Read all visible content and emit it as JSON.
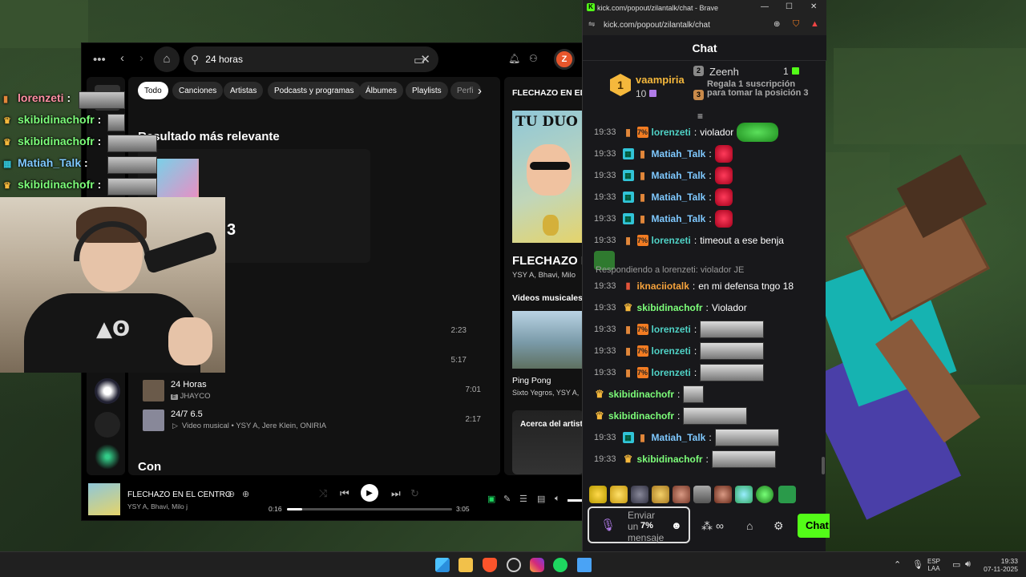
{
  "spotify": {
    "search_value": "24 horas",
    "avatar_letter": "Z",
    "filters": [
      "Todo",
      "Canciones",
      "Artistas",
      "Podcasts y programas",
      "Álbumes",
      "Playlists",
      "Perfi"
    ],
    "relevant_title": "Resultado más relevante",
    "relevant_fragment": "3",
    "durations": [
      "2:23",
      "5:17"
    ],
    "songs": [
      {
        "title": "24 Horas",
        "explicit": "E",
        "subtitle": "JHAYCO",
        "duration": "7:01"
      },
      {
        "title": "24/7 6.5",
        "explicit": "▷",
        "subtitle": "Video musical • YSY A, Jere Klein, ONIRIA",
        "duration": "2:17"
      }
    ],
    "section_con": "Con",
    "now_playing_panel": {
      "header": "FLECHAZO EN EL C",
      "cover_text": "TU DUO",
      "title": "FLECHAZO E",
      "artists": "YSY A, Bhavi, Milo",
      "videos_label": "Videos musicales",
      "video_title": "Ping Pong",
      "video_artists": "Sixto Yegros, YSY A,",
      "about_label": "Acerca del artista"
    },
    "player": {
      "title": "FLECHAZO EN EL CENTRO",
      "artists": "YSY A, Bhavi, Milo j",
      "elapsed": "0:16",
      "total": "3:05",
      "progress": 0.09
    }
  },
  "overlay_chat": [
    {
      "user": "lorenzeti",
      "color": "#ff8fa3",
      "suffix": ":"
    },
    {
      "user": "skibidinachofr",
      "color": "#7dff7a",
      "suffix": ":"
    },
    {
      "user": "skibidinachofr",
      "color": "#7dff7a",
      "suffix": ":"
    },
    {
      "user": "Matiah_Talk",
      "color": "#7fc9ff",
      "suffix": ":"
    },
    {
      "user": "skibidinachofr",
      "color": "#7dff7a",
      "suffix": ":"
    }
  ],
  "browser": {
    "title": "kick.com/popout/zilantalk/chat - Brave",
    "url": "kick.com/popout/zilantalk/chat",
    "chat_header": "Chat"
  },
  "leaderboard": {
    "first": {
      "rank": "1",
      "name": "vaampiria",
      "count": "10"
    },
    "second": {
      "rank": "2",
      "name": "Zeenh",
      "count": "1"
    },
    "third": {
      "rank": "3",
      "text": "Regala 1 suscripción para tomar la posición 3"
    }
  },
  "messages": [
    {
      "time": "19:33",
      "badges": [
        "cup",
        "pct"
      ],
      "user": "lorenzeti",
      "color": "#4fd1c5",
      "text": "violador",
      "emote": "green"
    },
    {
      "time": "19:33",
      "badges": [
        "kg",
        "cup"
      ],
      "user": "Matiah_Talk",
      "color": "#7fc9ff",
      "text": "",
      "emote": "red"
    },
    {
      "time": "19:33",
      "badges": [
        "kg",
        "cup"
      ],
      "user": "Matiah_Talk",
      "color": "#7fc9ff",
      "text": "",
      "emote": "red"
    },
    {
      "time": "19:33",
      "badges": [
        "kg",
        "cup"
      ],
      "user": "Matiah_Talk",
      "color": "#7fc9ff",
      "text": "",
      "emote": "red"
    },
    {
      "time": "19:33",
      "badges": [
        "kg",
        "cup"
      ],
      "user": "Matiah_Talk",
      "color": "#7fc9ff",
      "text": "",
      "emote": "red"
    },
    {
      "time": "19:33",
      "badges": [
        "cup",
        "pct"
      ],
      "user": "lorenzeti",
      "color": "#4fd1c5",
      "text": "timeout a ese benja",
      "emote": "frog"
    },
    {
      "time": "19:33",
      "badges": [
        "gift"
      ],
      "user": "iknaciiotalk",
      "color": "#f5a23c",
      "text": "en mi defensa tngo 18",
      "emote": "",
      "reply": "Respondiendo a lorenzeti: violador JE"
    },
    {
      "time": "19:33",
      "badges": [
        "crown"
      ],
      "user": "skibidinachofr",
      "color": "#7dff7a",
      "text": "Violador",
      "emote": ""
    },
    {
      "time": "19:33",
      "badges": [
        "cup",
        "pct"
      ],
      "user": "lorenzeti",
      "color": "#4fd1c5",
      "text": "",
      "emote": "face"
    },
    {
      "time": "19:33",
      "badges": [
        "cup",
        "pct"
      ],
      "user": "lorenzeti",
      "color": "#4fd1c5",
      "text": "",
      "emote": "face"
    },
    {
      "time": "19:33",
      "badges": [
        "cup",
        "pct"
      ],
      "user": "lorenzeti",
      "color": "#4fd1c5",
      "text": "",
      "emote": "face"
    },
    {
      "time": "",
      "badges": [
        "crown"
      ],
      "user": "skibidinachofr",
      "color": "#7dff7a",
      "text": "",
      "emote": "smallface"
    },
    {
      "time": "",
      "badges": [
        "crown"
      ],
      "user": "skibidinachofr",
      "color": "#7dff7a",
      "text": "",
      "emote": "face"
    },
    {
      "time": "19:33",
      "badges": [
        "kg",
        "cup"
      ],
      "user": "Matiah_Talk",
      "color": "#7fc9ff",
      "text": "",
      "emote": "face"
    },
    {
      "time": "19:33",
      "badges": [
        "crown"
      ],
      "user": "skibidinachofr",
      "color": "#7dff7a",
      "text": "",
      "emote": "face"
    }
  ],
  "chat_input": {
    "placeholder": "Enviar un mensaje",
    "kick_emote": "7%",
    "send_label": "Chat"
  },
  "taskbar": {
    "lang_top": "ESP",
    "lang_bottom": "LAA",
    "time": "19:33",
    "date": "07-11-2025"
  },
  "colors": {
    "kick_green": "#53fc18",
    "spotify_bg": "#121212",
    "chat_bg": "#18181b"
  }
}
